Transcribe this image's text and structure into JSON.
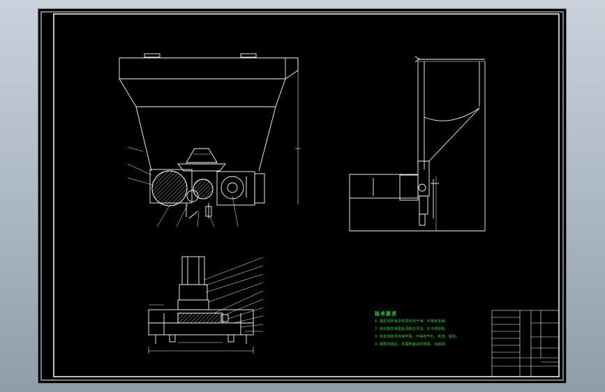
{
  "drawing": {
    "colors": {
      "background": "#000000",
      "line": "#ffffff",
      "notes": "#1fe01f",
      "hatch": "#d8d8d8"
    },
    "technical_notes": {
      "title": "技术要求",
      "items": [
        "1. 装配前所有零件须清洗干净，不得有毛刺。",
        "2. 转动部件装配后须转动灵活，无卡滞现象。",
        "3. 所有焊缝须焊接牢固，不得有气孔、夹渣、裂纹。",
        "4. 装配完成后，外露表面涂防锈漆，涂面漆。"
      ]
    }
  }
}
